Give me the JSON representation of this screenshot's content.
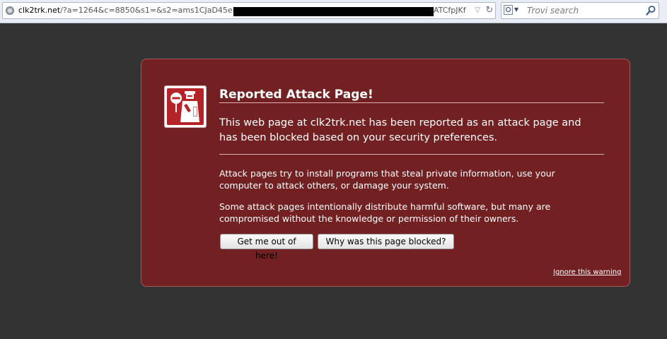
{
  "browser": {
    "url_domain": "clk2trk.net",
    "url_path_visible": "/?a=1264&c=8850&s1=&s2=ams1CJaD45eFq",
    "url_tail_visible": "ATCfpJKf",
    "search_placeholder": "Trovi search",
    "icons": {
      "site": "globe-icon",
      "dropdown": "chevron-down-icon",
      "reload": "reload-icon",
      "search_engine": "search-engine-icon",
      "search_go": "magnifier-icon"
    }
  },
  "warning": {
    "title": "Reported Attack Page!",
    "short_desc": "This web page at clk2trk.net has been reported as an attack page and has been blocked based on your security preferences.",
    "long_desc_1": "Attack pages try to install programs that steal private information, use your computer to attack others, or damage your system.",
    "long_desc_2": "Some attack pages intentionally distribute harmful software, but many are compromised without the knowledge or permission of their owners.",
    "button_get_out": "Get me out of here!",
    "button_why": "Why was this page blocked?",
    "ignore_link": "Ignore this warning",
    "icon": "police-officer-stop-icon"
  },
  "colors": {
    "background": "#333333",
    "panel": "#722021",
    "badge_red": "#b52327",
    "text": "#ffffff"
  }
}
